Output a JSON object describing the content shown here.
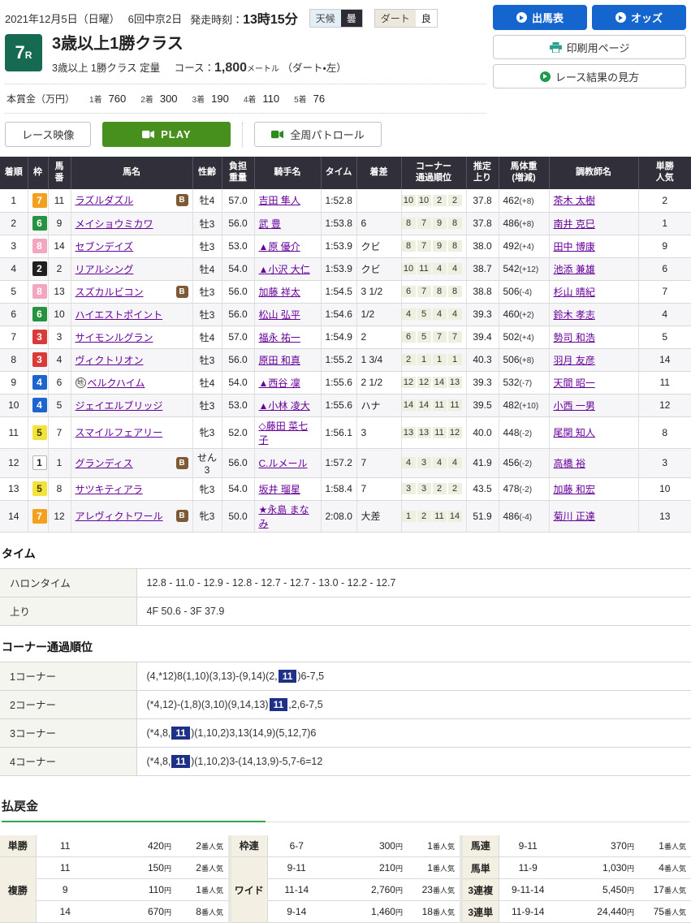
{
  "colors": {
    "accent_blue": "#1565cf",
    "accent_green": "#2fa84d",
    "race_green": "#176a52",
    "play_green": "#47901d",
    "header_dark": "#312f39",
    "corner_highlight": "#1e3187"
  },
  "header": {
    "date": "2021年12月5日（日曜）",
    "meeting": "6回中京2日",
    "start_label": "発走時刻：",
    "start_time": "13時15分",
    "weather_label": "天候",
    "weather_value": "曇",
    "track_label": "ダート",
    "track_value": "良",
    "buttons": {
      "entries": "出馬表",
      "odds": "オッズ",
      "print": "印刷用ページ",
      "guide": "レース結果の見方"
    }
  },
  "race": {
    "number": "7",
    "number_suffix": "R",
    "title": "3歳以上1勝クラス",
    "conditions": "3歳以上 1勝クラス 定量",
    "course_label": "コース：",
    "course_distance": "1,800",
    "course_unit": "メートル",
    "course_note": "（ダート・左）",
    "prize_label": "本賞金（万円）",
    "prizes": [
      {
        "place": "1着",
        "amount": "760"
      },
      {
        "place": "2着",
        "amount": "300"
      },
      {
        "place": "3着",
        "amount": "190"
      },
      {
        "place": "4着",
        "amount": "110"
      },
      {
        "place": "5着",
        "amount": "76"
      }
    ]
  },
  "video": {
    "label": "レース映像",
    "play": "PLAY",
    "patrol": "全周パトロール"
  },
  "results": {
    "headers": [
      "着順",
      "枠",
      "馬\n番",
      "馬名",
      "性齢",
      "負担\n重量",
      "騎手名",
      "タイム",
      "着差",
      "コーナー\n通過順位",
      "推定\n上り",
      "馬体重\n(増減)",
      "調教師名",
      "単勝\n人気"
    ],
    "rows": [
      {
        "pos": "1",
        "waku": "7",
        "num": "11",
        "name": "ラズルダズル",
        "b": true,
        "sexage": "牡4",
        "weight": "57.0",
        "jockey": "吉田 隼人",
        "time": "1:52.8",
        "margin": "",
        "corners": [
          "10",
          "10",
          "2",
          "2"
        ],
        "agari": "37.8",
        "body": "462",
        "diff": "(+8)",
        "trainer": "茶木 太樹",
        "pop": "2"
      },
      {
        "pos": "2",
        "waku": "6",
        "num": "9",
        "name": "メイショウミカワ",
        "sexage": "牡3",
        "weight": "56.0",
        "jockey": "武 豊",
        "time": "1:53.8",
        "margin": "6",
        "corners": [
          "8",
          "7",
          "9",
          "8"
        ],
        "agari": "37.8",
        "body": "486",
        "diff": "(+8)",
        "trainer": "南井 克巳",
        "pop": "1"
      },
      {
        "pos": "3",
        "waku": "8",
        "num": "14",
        "name": "セブンデイズ",
        "sexage": "牡3",
        "weight": "53.0",
        "jockey": "▲原 優介",
        "time": "1:53.9",
        "margin": "クビ",
        "corners": [
          "8",
          "7",
          "9",
          "8"
        ],
        "agari": "38.0",
        "body": "492",
        "diff": "(+4)",
        "trainer": "田中 博康",
        "pop": "9"
      },
      {
        "pos": "4",
        "waku": "2",
        "num": "2",
        "name": "リアルシング",
        "sexage": "牡4",
        "weight": "54.0",
        "jockey": "▲小沢 大仁",
        "time": "1:53.9",
        "margin": "クビ",
        "corners": [
          "10",
          "11",
          "4",
          "4"
        ],
        "agari": "38.7",
        "body": "542",
        "diff": "(+12)",
        "trainer": "池添 兼雄",
        "pop": "6"
      },
      {
        "pos": "5",
        "waku": "8",
        "num": "13",
        "name": "スズカルビコン",
        "b": true,
        "sexage": "牡3",
        "weight": "56.0",
        "jockey": "加藤 祥太",
        "time": "1:54.5",
        "margin": "3 1/2",
        "corners": [
          "6",
          "7",
          "8",
          "8"
        ],
        "agari": "38.8",
        "body": "506",
        "diff": "(-4)",
        "trainer": "杉山 晴紀",
        "pop": "7"
      },
      {
        "pos": "6",
        "waku": "6",
        "num": "10",
        "name": "ハイエストポイント",
        "sexage": "牡3",
        "weight": "56.0",
        "jockey": "松山 弘平",
        "time": "1:54.6",
        "margin": "1/2",
        "corners": [
          "4",
          "5",
          "4",
          "4"
        ],
        "agari": "39.3",
        "body": "460",
        "diff": "(+2)",
        "trainer": "鈴木 孝志",
        "pop": "4"
      },
      {
        "pos": "7",
        "waku": "3",
        "num": "3",
        "name": "サイモンルグラン",
        "sexage": "牡4",
        "weight": "57.0",
        "jockey": "福永 祐一",
        "time": "1:54.9",
        "margin": "2",
        "corners": [
          "6",
          "5",
          "7",
          "7"
        ],
        "agari": "39.4",
        "body": "502",
        "diff": "(+4)",
        "trainer": "勢司 和浩",
        "pop": "5"
      },
      {
        "pos": "8",
        "waku": "3",
        "num": "4",
        "name": "ヴィクトリオン",
        "sexage": "牡3",
        "weight": "56.0",
        "jockey": "原田 和真",
        "time": "1:55.2",
        "margin": "1 3/4",
        "corners": [
          "2",
          "1",
          "1",
          "1"
        ],
        "agari": "40.3",
        "body": "506",
        "diff": "(+8)",
        "trainer": "羽月 友彦",
        "pop": "14"
      },
      {
        "pos": "9",
        "waku": "4",
        "num": "6",
        "name": "ベルクハイム",
        "mark": "地",
        "sexage": "牡4",
        "weight": "54.0",
        "jockey": "▲西谷 凜",
        "time": "1:55.6",
        "margin": "2 1/2",
        "corners": [
          "12",
          "12",
          "14",
          "13"
        ],
        "agari": "39.3",
        "body": "532",
        "diff": "(-7)",
        "trainer": "天間 昭一",
        "pop": "11"
      },
      {
        "pos": "10",
        "waku": "4",
        "num": "5",
        "name": "ジェイエルブリッジ",
        "sexage": "牡3",
        "weight": "53.0",
        "jockey": "▲小林 凌大",
        "time": "1:55.6",
        "margin": "ハナ",
        "corners": [
          "14",
          "14",
          "11",
          "11"
        ],
        "agari": "39.5",
        "body": "482",
        "diff": "(+10)",
        "trainer": "小西 一男",
        "pop": "12"
      },
      {
        "pos": "11",
        "waku": "5",
        "num": "7",
        "name": "スマイルフェアリー",
        "sexage": "牝3",
        "weight": "52.0",
        "jockey": "◇藤田 菜七子",
        "time": "1:56.1",
        "margin": "3",
        "corners": [
          "13",
          "13",
          "11",
          "12"
        ],
        "agari": "40.0",
        "body": "448",
        "diff": "(-2)",
        "trainer": "尾関 知人",
        "pop": "8"
      },
      {
        "pos": "12",
        "waku": "1",
        "num": "1",
        "name": "グランディス",
        "b": true,
        "sexage": "せん3",
        "weight": "56.0",
        "jockey": "C.ルメール",
        "time": "1:57.2",
        "margin": "7",
        "corners": [
          "4",
          "3",
          "4",
          "4"
        ],
        "agari": "41.9",
        "body": "456",
        "diff": "(-2)",
        "trainer": "高橋 裕",
        "pop": "3"
      },
      {
        "pos": "13",
        "waku": "5",
        "num": "8",
        "name": "サツキティアラ",
        "sexage": "牝3",
        "weight": "54.0",
        "jockey": "坂井 瑠星",
        "time": "1:58.4",
        "margin": "7",
        "corners": [
          "3",
          "3",
          "2",
          "2"
        ],
        "agari": "43.5",
        "body": "478",
        "diff": "(-2)",
        "trainer": "加藤 和宏",
        "pop": "10"
      },
      {
        "pos": "14",
        "waku": "7",
        "num": "12",
        "name": "アレヴィクトワール",
        "b": true,
        "sexage": "牝3",
        "weight": "50.0",
        "jockey": "★永島 まなみ",
        "time": "2:08.0",
        "margin": "大差",
        "corners": [
          "1",
          "2",
          "11",
          "14"
        ],
        "agari": "51.9",
        "body": "486",
        "diff": "(-4)",
        "trainer": "菊川 正達",
        "pop": "13"
      }
    ]
  },
  "time_section": {
    "title": "タイム",
    "rows": [
      {
        "label": "ハロンタイム",
        "value": "12.8 - 11.0 - 12.9 - 12.8 - 12.7 - 12.7 - 13.0 - 12.2 - 12.7"
      },
      {
        "label": "上り",
        "value": "4F 50.6 - 3F 37.9"
      }
    ]
  },
  "corner_section": {
    "title": "コーナー通過順位",
    "rows": [
      {
        "label": "1コーナー",
        "pre": "(4,*12)8(1,10)(3,13)-(9,14)(2,",
        "hl": "11",
        "post": ")6-7,5"
      },
      {
        "label": "2コーナー",
        "pre": "(*4,12)-(1,8)(3,10)(9,14,13)",
        "hl": "11",
        "post": ",2,6-7,5"
      },
      {
        "label": "3コーナー",
        "pre": "(*4,8,",
        "hl": "11",
        "post": ")(1,10,2)3,13(14,9)(5,12,7)6"
      },
      {
        "label": "4コーナー",
        "pre": "(*4,8,",
        "hl": "11",
        "post": ")(1,10,2)3-(14,13,9)-5,7-6=12"
      }
    ]
  },
  "payout": {
    "title": "払戻金",
    "yen": "円",
    "pop_suffix": "番人気",
    "tables": [
      {
        "groups": [
          {
            "label": "単勝",
            "rows": [
              {
                "combo": "11",
                "amount": "420",
                "pop": "2"
              }
            ]
          },
          {
            "label": "複勝",
            "rows": [
              {
                "combo": "11",
                "amount": "150",
                "pop": "2"
              },
              {
                "combo": "9",
                "amount": "110",
                "pop": "1"
              },
              {
                "combo": "14",
                "amount": "670",
                "pop": "8"
              }
            ]
          }
        ]
      },
      {
        "groups": [
          {
            "label": "枠連",
            "rows": [
              {
                "combo": "6-7",
                "amount": "300",
                "pop": "1"
              }
            ]
          },
          {
            "label": "ワイド",
            "rows": [
              {
                "combo": "9-11",
                "amount": "210",
                "pop": "1"
              },
              {
                "combo": "11-14",
                "amount": "2,760",
                "pop": "23"
              },
              {
                "combo": "9-14",
                "amount": "1,460",
                "pop": "18"
              }
            ]
          }
        ]
      },
      {
        "groups": [
          {
            "label": "馬連",
            "rows": [
              {
                "combo": "9-11",
                "amount": "370",
                "pop": "1"
              }
            ]
          },
          {
            "label": "馬単",
            "rows": [
              {
                "combo": "11-9",
                "amount": "1,030",
                "pop": "4"
              }
            ]
          },
          {
            "label": "3連複",
            "rows": [
              {
                "combo": "9-11-14",
                "amount": "5,450",
                "pop": "17"
              }
            ]
          },
          {
            "label": "3連単",
            "rows": [
              {
                "combo": "11-9-14",
                "amount": "24,440",
                "pop": "75"
              }
            ]
          }
        ]
      }
    ]
  }
}
